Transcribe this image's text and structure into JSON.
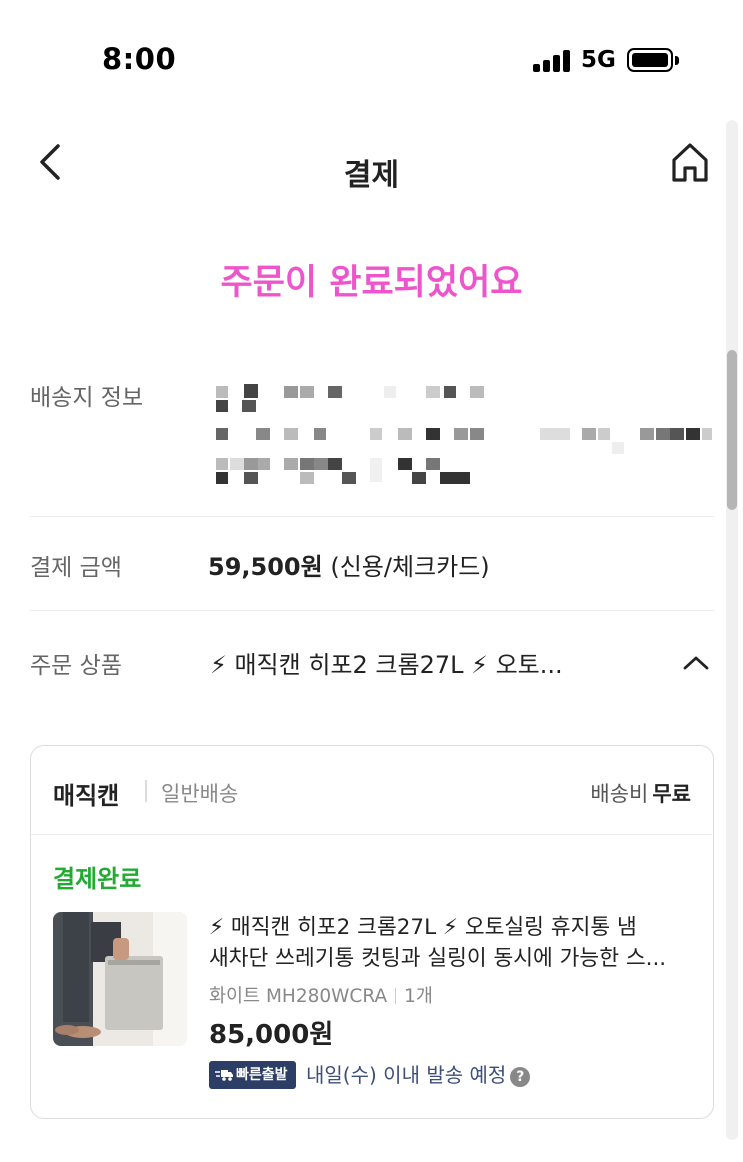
{
  "status_bar": {
    "time": "8:00",
    "network": "5G"
  },
  "header": {
    "title": "결제",
    "back_icon": "chevron-left-icon",
    "home_icon": "home-icon"
  },
  "complete_message": "주문이 완료되었어요",
  "colors": {
    "accent_pink": "#ee55cc",
    "paid_green": "#22aa33",
    "badge_navy": "#2c3e66"
  },
  "shipping_info": {
    "label": "배송지 정보"
  },
  "payment": {
    "label": "결제 금액",
    "amount": "59,500원",
    "method": "(신용/체크카드)"
  },
  "order_items": {
    "label": "주문 상품",
    "summary": "⚡ 매직캔 히포2 크롬27L ⚡  오토...",
    "toggle_icon": "chevron-up-icon"
  },
  "order_card": {
    "seller": "매직캔",
    "shipping_type": "일반배송",
    "shipping_fee_label": "배송비",
    "shipping_fee_value": "무료",
    "status": "결제완료",
    "product": {
      "name_line1": "⚡ 매직캔 히포2 크롬27L ⚡  오토실링 휴지통 냄",
      "name_line2": "새차단 쓰레기통 컷팅과 실링이 동시에 가능한 스...",
      "option": "화이트 MH280WCRA",
      "quantity": "1개",
      "price": "85,000원",
      "badge": "빠른출발",
      "delivery_eta": "내일(수) 이내 발송 예정",
      "help_icon": "question-circle-icon"
    }
  }
}
